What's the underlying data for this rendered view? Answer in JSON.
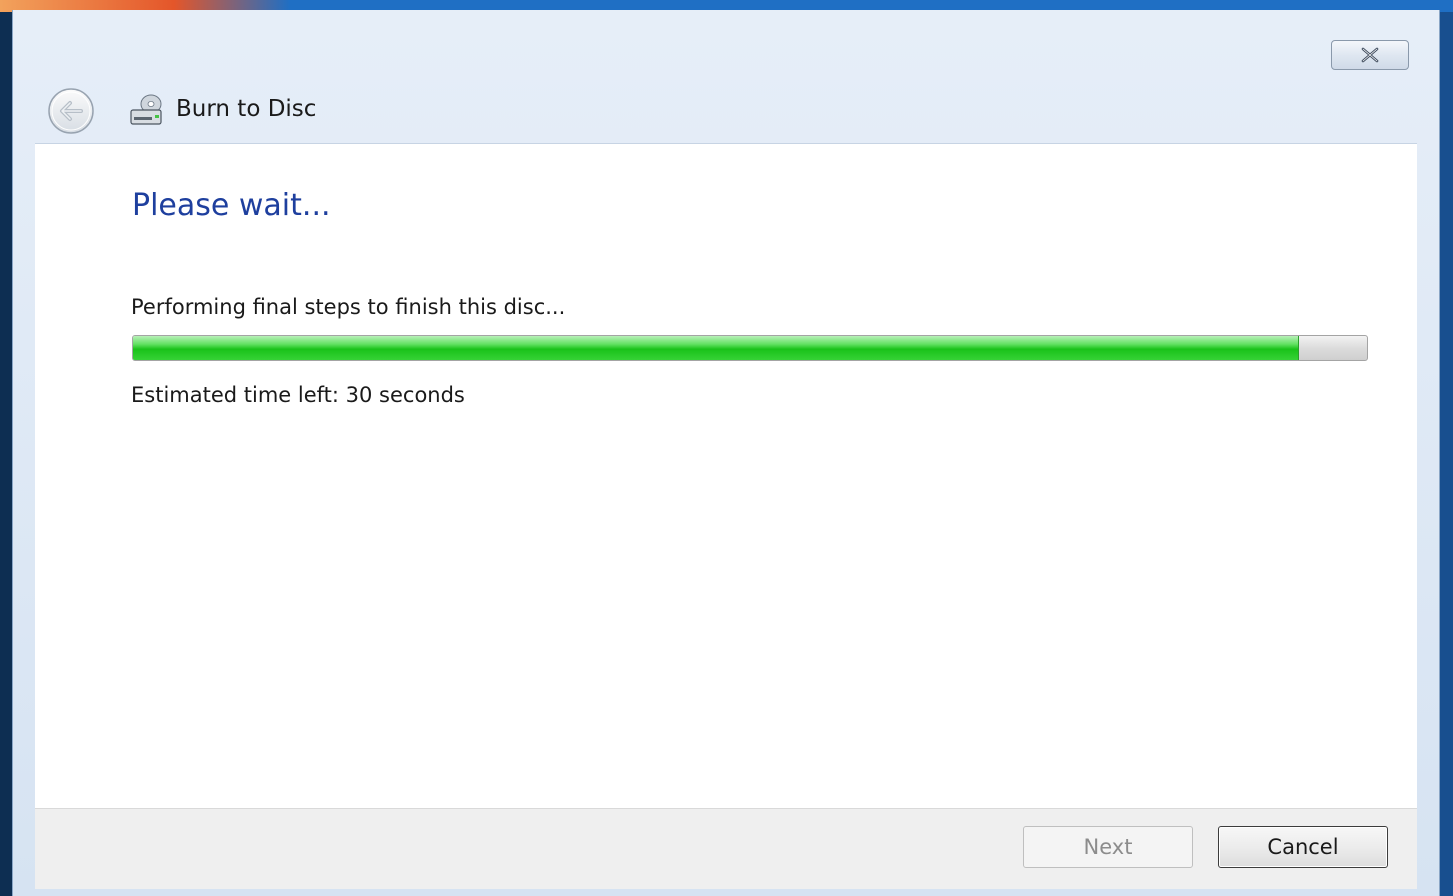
{
  "window": {
    "title": "Burn to Disc"
  },
  "main": {
    "heading": "Please wait...",
    "status_text": "Performing final steps to finish this disc...",
    "eta_text": "Estimated time left: 30 seconds",
    "progress_fraction": 0.945
  },
  "footer": {
    "next_label": "Next",
    "cancel_label": "Cancel"
  },
  "icons": {
    "back": "back-arrow-icon",
    "close": "close-icon",
    "title": "disc-burn-icon"
  },
  "colors": {
    "heading": "#1e3f9e",
    "progress_fill": "#1ac21a",
    "window_frame": "#d6e3f2"
  }
}
